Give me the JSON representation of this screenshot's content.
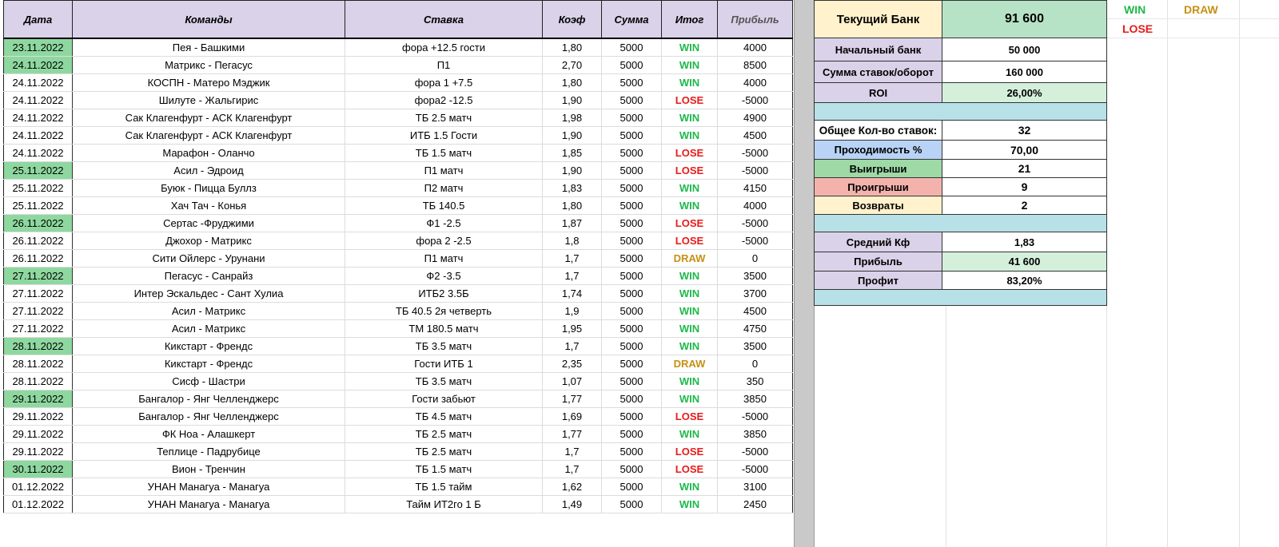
{
  "headers": {
    "date": "Дата",
    "teams": "Команды",
    "bet": "Ставка",
    "coef": "Коэф",
    "sum": "Сумма",
    "result": "Итог",
    "profit": "Прибыль"
  },
  "rows": [
    {
      "date": "23.11.2022",
      "teams": "Пея - Башкими",
      "bet": "фора +12.5 гости",
      "coef": "1,80",
      "sum": "5000",
      "result": "WIN",
      "profit": "4000",
      "hl": true
    },
    {
      "date": "24.11.2022",
      "teams": "Матрикс - Пегасус",
      "bet": "П1",
      "coef": "2,70",
      "sum": "5000",
      "result": "WIN",
      "profit": "8500",
      "hl": true
    },
    {
      "date": "24.11.2022",
      "teams": "КОСПН - Матеро Мэджик",
      "bet": "фора 1 +7.5",
      "coef": "1,80",
      "sum": "5000",
      "result": "WIN",
      "profit": "4000",
      "hl": false
    },
    {
      "date": "24.11.2022",
      "teams": "Шилуте - Жальгирис",
      "bet": "фора2 -12.5",
      "coef": "1,90",
      "sum": "5000",
      "result": "LOSE",
      "profit": "-5000",
      "hl": false
    },
    {
      "date": "24.11.2022",
      "teams": "Сак Клагенфурт - АСК Клагенфурт",
      "bet": "ТБ 2.5 матч",
      "coef": "1,98",
      "sum": "5000",
      "result": "WIN",
      "profit": "4900",
      "hl": false
    },
    {
      "date": "24.11.2022",
      "teams": "Сак Клагенфурт - АСК Клагенфурт",
      "bet": "ИТБ 1.5 Гости",
      "coef": "1,90",
      "sum": "5000",
      "result": "WIN",
      "profit": "4500",
      "hl": false
    },
    {
      "date": "24.11.2022",
      "teams": "Марафон - Оланчо",
      "bet": "ТБ 1.5 матч",
      "coef": "1,85",
      "sum": "5000",
      "result": "LOSE",
      "profit": "-5000",
      "hl": false
    },
    {
      "date": "25.11.2022",
      "teams": "Асил - Эдроид",
      "bet": "П1 матч",
      "coef": "1,90",
      "sum": "5000",
      "result": "LOSE",
      "profit": "-5000",
      "hl": true
    },
    {
      "date": "25.11.2022",
      "teams": "Буюк - Пицца Буллз",
      "bet": "П2 матч",
      "coef": "1,83",
      "sum": "5000",
      "result": "WIN",
      "profit": "4150",
      "hl": false
    },
    {
      "date": "25.11.2022",
      "teams": "Хач Тач - Конья",
      "bet": "ТБ 140.5",
      "coef": "1,80",
      "sum": "5000",
      "result": "WIN",
      "profit": "4000",
      "hl": false
    },
    {
      "date": "26.11.2022",
      "teams": "Сертас -Фруджими",
      "bet": "Ф1 -2.5",
      "coef": "1,87",
      "sum": "5000",
      "result": "LOSE",
      "profit": "-5000",
      "hl": true
    },
    {
      "date": "26.11.2022",
      "teams": "Джохор - Матрикс",
      "bet": "фора 2 -2.5",
      "coef": "1,8",
      "sum": "5000",
      "result": "LOSE",
      "profit": "-5000",
      "hl": false
    },
    {
      "date": "26.11.2022",
      "teams": "Сити Ойлерс - Урунани",
      "bet": "П1 матч",
      "coef": "1,7",
      "sum": "5000",
      "result": "DRAW",
      "profit": "0",
      "hl": false
    },
    {
      "date": "27.11.2022",
      "teams": "Пегасус - Санрайз",
      "bet": "Ф2 -3.5",
      "coef": "1,7",
      "sum": "5000",
      "result": "WIN",
      "profit": "3500",
      "hl": true
    },
    {
      "date": "27.11.2022",
      "teams": "Интер Эскальдес - Сант Хулиа",
      "bet": "ИТБ2 3.5Б",
      "coef": "1,74",
      "sum": "5000",
      "result": "WIN",
      "profit": "3700",
      "hl": false
    },
    {
      "date": "27.11.2022",
      "teams": "Асил - Матрикс",
      "bet": "ТБ 40.5 2я четверть",
      "coef": "1,9",
      "sum": "5000",
      "result": "WIN",
      "profit": "4500",
      "hl": false
    },
    {
      "date": "27.11.2022",
      "teams": "Асил - Матрикс",
      "bet": "ТМ 180.5 матч",
      "coef": "1,95",
      "sum": "5000",
      "result": "WIN",
      "profit": "4750",
      "hl": false
    },
    {
      "date": "28.11.2022",
      "teams": "Кикстарт - Френдс",
      "bet": "ТБ 3.5 матч",
      "coef": "1,7",
      "sum": "5000",
      "result": "WIN",
      "profit": "3500",
      "hl": true
    },
    {
      "date": "28.11.2022",
      "teams": "Кикстарт - Френдс",
      "bet": "Гости ИТБ 1",
      "coef": "2,35",
      "sum": "5000",
      "result": "DRAW",
      "profit": "0",
      "hl": false
    },
    {
      "date": "28.11.2022",
      "teams": "Сисф - Шастри",
      "bet": "ТБ 3.5 матч",
      "coef": "1,07",
      "sum": "5000",
      "result": "WIN",
      "profit": "350",
      "hl": false
    },
    {
      "date": "29.11.2022",
      "teams": "Бангалор - Янг Челленджерс",
      "bet": "Гости забьют",
      "coef": "1,77",
      "sum": "5000",
      "result": "WIN",
      "profit": "3850",
      "hl": true
    },
    {
      "date": "29.11.2022",
      "teams": "Бангалор - Янг Челленджерс",
      "bet": "ТБ 4.5 матч",
      "coef": "1,69",
      "sum": "5000",
      "result": "LOSE",
      "profit": "-5000",
      "hl": false
    },
    {
      "date": "29.11.2022",
      "teams": "ФК Ноа - Алашкерт",
      "bet": "ТБ 2.5 матч",
      "coef": "1,77",
      "sum": "5000",
      "result": "WIN",
      "profit": "3850",
      "hl": false
    },
    {
      "date": "29.11.2022",
      "teams": "Теплице - Падрубице",
      "bet": "ТБ 2.5 матч",
      "coef": "1,7",
      "sum": "5000",
      "result": "LOSE",
      "profit": "-5000",
      "hl": false
    },
    {
      "date": "30.11.2022",
      "teams": "Вион - Тренчин",
      "bet": "ТБ 1.5 матч",
      "coef": "1,7",
      "sum": "5000",
      "result": "LOSE",
      "profit": "-5000",
      "hl": true
    },
    {
      "date": "01.12.2022",
      "teams": "УНАН Манагуа - Манагуа",
      "bet": "ТБ 1.5 тайм",
      "coef": "1,62",
      "sum": "5000",
      "result": "WIN",
      "profit": "3100",
      "hl": false
    },
    {
      "date": "01.12.2022",
      "teams": "УНАН Манагуа - Манагуа",
      "bet": "Тайм ИТ2го 1 Б",
      "coef": "1,49",
      "sum": "5000",
      "result": "WIN",
      "profit": "2450",
      "hl": false
    }
  ],
  "stats": {
    "current_bank_label": "Текущий Банк",
    "current_bank_value": "91 600",
    "start_bank_label": "Начальный банк",
    "start_bank_value": "50 000",
    "turnover_label": "Сумма ставок/оборот",
    "turnover_value": "160 000",
    "roi_label": "ROI",
    "roi_value": "26,00%",
    "total_bets_label": "Общее Кол-во ставок:",
    "total_bets_value": "32",
    "pass_rate_label": "Проходимость %",
    "pass_rate_value": "70,00",
    "wins_label": "Выигрыши",
    "wins_value": "21",
    "losses_label": "Проигрыши",
    "losses_value": "9",
    "returns_label": "Возвраты",
    "returns_value": "2",
    "avg_coef_label": "Средний Кф",
    "avg_coef_value": "1,83",
    "profit_label": "Прибыль",
    "profit_value": "41 600",
    "profit_pct_label": "Профит",
    "profit_pct_value": "83,20%"
  },
  "legend": {
    "win": "WIN",
    "draw": "DRAW",
    "lose": "LOSE"
  },
  "colors": {
    "win": "#1fb84a",
    "lose": "#e81a1a",
    "draw": "#c59114",
    "date_highlight": "#8ed8a0",
    "header_bg": "#d9d2e9"
  }
}
